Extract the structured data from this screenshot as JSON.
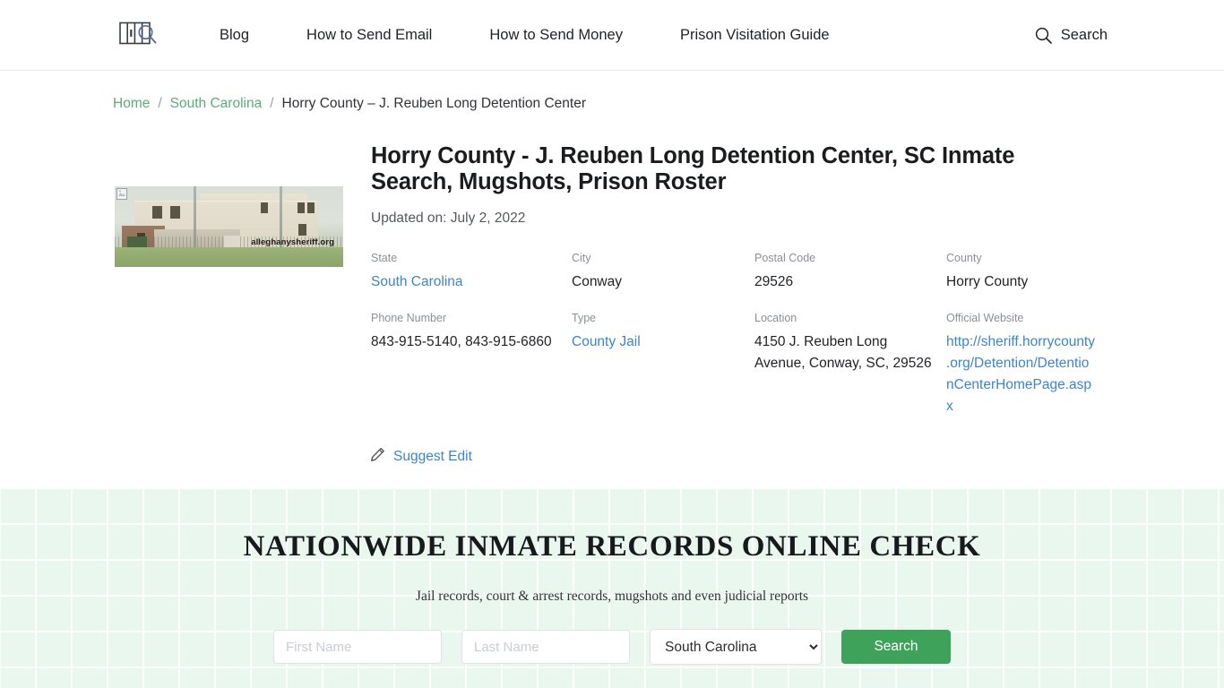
{
  "header": {
    "logo_name": "jail-bars-magnifier-logo",
    "nav": [
      {
        "label": "Blog"
      },
      {
        "label": "How to Send Email"
      },
      {
        "label": "How to Send Money"
      },
      {
        "label": "Prison Visitation Guide"
      }
    ],
    "search": {
      "label": "Search",
      "icon": "search-icon"
    }
  },
  "breadcrumb": {
    "home": "Home",
    "state": "South Carolina",
    "current": "Horry County – J. Reuben Long Detention Center",
    "separator": "/"
  },
  "facility": {
    "photo": {
      "alt": "J. Reuben Long Detention Center building",
      "watermark": "alleghanysheriff.org"
    },
    "title": "Horry County - J. Reuben Long Detention Center, SC Inmate Search, Mugshots, Prison Roster",
    "updated": "Updated on: July 2, 2022",
    "fields": [
      {
        "label": "State",
        "value": "South Carolina",
        "link": true
      },
      {
        "label": "City",
        "value": "Conway",
        "link": false
      },
      {
        "label": "Postal Code",
        "value": "29526",
        "link": false
      },
      {
        "label": "County",
        "value": "Horry County",
        "link": false
      },
      {
        "label": "Phone Number",
        "value": "843-915-5140, 843-915-6860",
        "link": false
      },
      {
        "label": "Type",
        "value": "County Jail",
        "link": true
      },
      {
        "label": "Location",
        "value": "4150 J. Reuben Long Avenue, Conway, SC, 29526",
        "link": false
      },
      {
        "label": "Official Website",
        "value": "http://sheriff.horrycounty.org/Detention/DetentionCenterHomePage.aspx",
        "link": true
      }
    ],
    "suggest_edit": {
      "label": "Suggest Edit",
      "icon": "pencil-icon"
    }
  },
  "promo": {
    "title": "NATIONWIDE INMATE RECORDS ONLINE CHECK",
    "subtitle": "Jail records, court & arrest records, mugshots and even judicial reports",
    "first_name": {
      "value": "",
      "placeholder": "First Name"
    },
    "last_name": {
      "value": "",
      "placeholder": "Last Name"
    },
    "state_select": {
      "selected": "South Carolina",
      "options": [
        "South Carolina"
      ]
    },
    "search_button": "Search"
  },
  "colors": {
    "brand_green": "#3fa25a",
    "breadcrumb_link": "#5bab78",
    "data_link": "#3d85c6",
    "promo_bg": "#eaf7ef",
    "text": "#1f2124",
    "muted": "#8b9096"
  }
}
